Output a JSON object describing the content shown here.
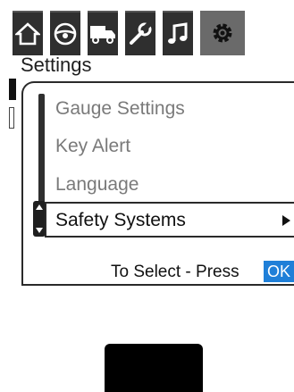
{
  "topbar": {
    "tabs": [
      {
        "icon": "home-icon"
      },
      {
        "icon": "steering-wheel-icon"
      },
      {
        "icon": "truck-icon"
      },
      {
        "icon": "wrench-icon"
      },
      {
        "icon": "music-note-icon"
      },
      {
        "icon": "settings-gear-icon",
        "active": true
      }
    ]
  },
  "page": {
    "title": "Settings"
  },
  "menu": {
    "items": [
      "Gauge Settings",
      "Key Alert",
      "Language"
    ],
    "selected": "Safety Systems"
  },
  "footer": {
    "hint": "To Select - Press",
    "ok_label": "OK"
  },
  "colors": {
    "accent": "#1f7fd8",
    "tab_bg": "#2f2f2f",
    "tab_active": "#6a6a6a"
  }
}
